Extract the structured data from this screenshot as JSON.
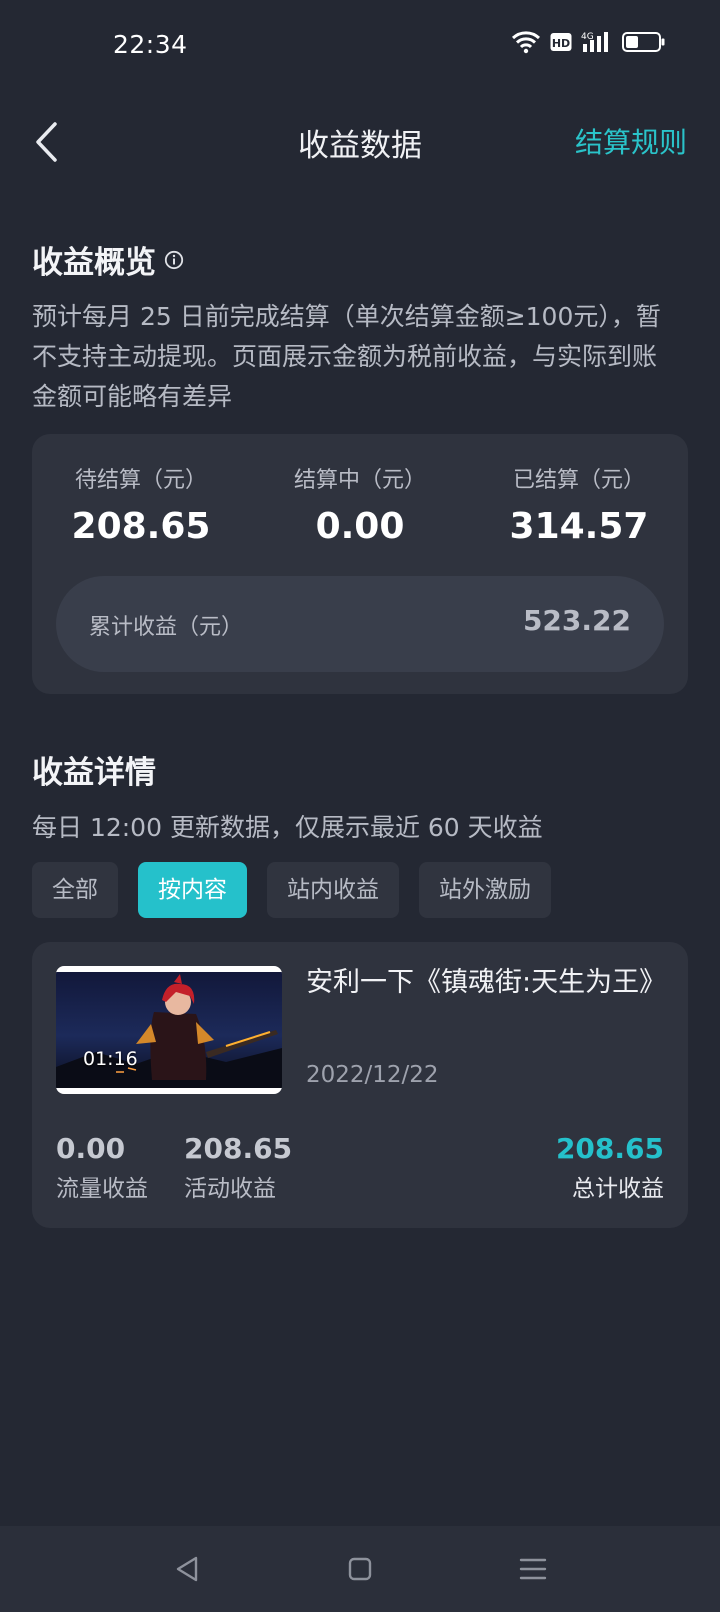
{
  "status_bar": {
    "time": "22:34",
    "icons": [
      "wifi-icon",
      "hd-icon",
      "signal-4g-icon",
      "battery-icon"
    ],
    "hd_label": "HD",
    "network_label": "4G"
  },
  "nav": {
    "back_icon": "chevron-left-icon",
    "title": "收益数据",
    "rules_link": "结算规则"
  },
  "overview": {
    "title": "收益概览",
    "description": "预计每月 25 日前完成结算（单次结算金额≥100元），暂不支持主动提现。页面展示金额为税前收益，与实际到账金额可能略有差异",
    "stats": [
      {
        "label": "待结算（元）",
        "value": "208.65"
      },
      {
        "label": "结算中（元）",
        "value": "0.00"
      },
      {
        "label": "已结算（元）",
        "value": "314.57"
      }
    ],
    "total": {
      "label": "累计收益（元）",
      "value": "523.22"
    }
  },
  "details": {
    "title": "收益详情",
    "description": "每日 12:00 更新数据，仅展示最近 60 天收益",
    "tabs": [
      {
        "label": "全部",
        "active": false
      },
      {
        "label": "按内容",
        "active": true
      },
      {
        "label": "站内收益",
        "active": false
      },
      {
        "label": "站外激励",
        "active": false
      }
    ],
    "items": [
      {
        "duration": "01:16",
        "title": "安利一下《镇魂街:天生为王》",
        "date": "2022/12/22",
        "traffic_income": {
          "value": "0.00",
          "label": "流量收益"
        },
        "activity_income": {
          "value": "208.65",
          "label": "活动收益"
        },
        "total_income": {
          "value": "208.65",
          "label": "总计收益"
        }
      }
    ]
  },
  "system_nav": [
    "triangle-back-icon",
    "square-home-icon",
    "menu-lines-icon"
  ],
  "colors": {
    "background": "#242833",
    "card": "#2f333e",
    "accent": "#25c1cb",
    "link": "#2ac3c9"
  }
}
